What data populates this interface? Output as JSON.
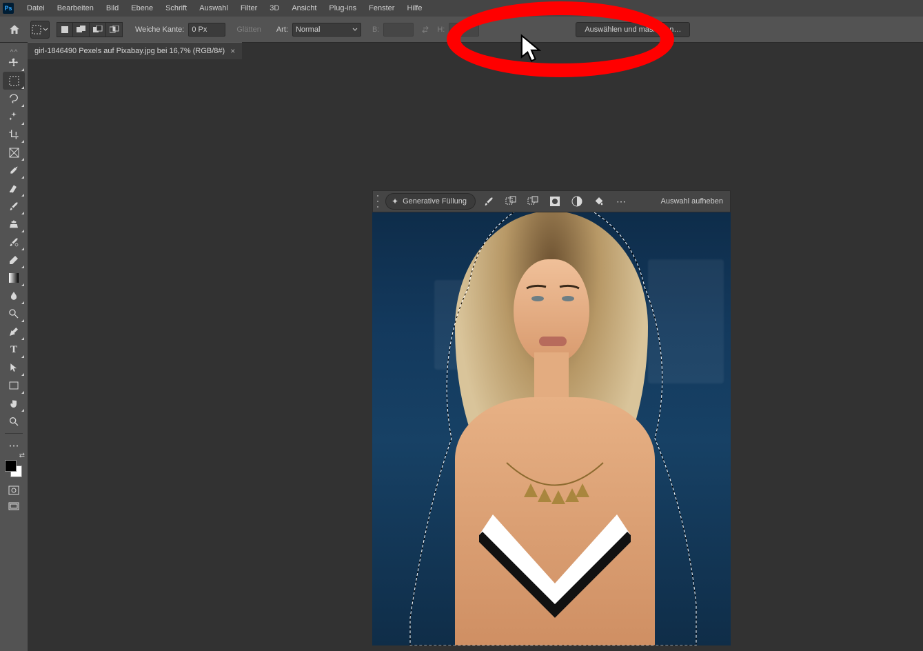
{
  "menubar": {
    "items": [
      "Datei",
      "Bearbeiten",
      "Bild",
      "Ebene",
      "Schrift",
      "Auswahl",
      "Filter",
      "3D",
      "Ansicht",
      "Plug-ins",
      "Fenster",
      "Hilfe"
    ]
  },
  "options": {
    "feather_label": "Weiche Kante:",
    "feather_value": "0 Px",
    "antialias_label": "Glätten",
    "style_label": "Art:",
    "style_value": "Normal",
    "width_label": "B:",
    "height_label": "H:",
    "select_and_mask": "Auswählen und maskieren…"
  },
  "tab": {
    "title": "girl-1846490 Pexels auf Pixabay.jpg bei 16,7% (RGB/8#)"
  },
  "ctxbar": {
    "gen_fill": "Generative Füllung",
    "deselect": "Auswahl aufheben"
  },
  "tools": {
    "list": [
      "move",
      "marquee",
      "lasso",
      "magic-wand",
      "crop",
      "frame",
      "eyedropper",
      "healing",
      "brush",
      "clone",
      "history-brush",
      "eraser",
      "gradient",
      "blur",
      "dodge",
      "pen",
      "type",
      "path-select",
      "rectangle",
      "hand",
      "zoom",
      "more"
    ]
  },
  "colors": {
    "accent_red": "#ff0000",
    "ui_bg": "#535353"
  },
  "ps_logo_text": "Ps"
}
